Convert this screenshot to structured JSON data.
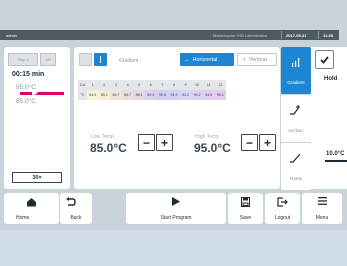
{
  "topbar": {
    "user": "admin",
    "device": "Mastercycler X50 Laborstation",
    "date": "2017-05-31",
    "time": "11:45"
  },
  "step": {
    "label": "Step 2",
    "counter": "1/3",
    "duration": "00:15 min",
    "temp_top": "95.0°C",
    "temp_bottom": "85.0°C",
    "cycles": "30×"
  },
  "gradient": {
    "title": "Gradient",
    "horizontal_label": "Horizontal",
    "vertical_label": "Vertical",
    "horizontal_arrow": "→",
    "vertical_arrow": "↑",
    "table": {
      "col_header": "Col",
      "columns": [
        "1",
        "2",
        "3",
        "4",
        "5",
        "6",
        "7",
        "8",
        "9",
        "10",
        "11",
        "12"
      ],
      "row_header": "°C",
      "values": [
        "84.9",
        "85.1",
        "85.7",
        "86.7",
        "88.1",
        "89.4",
        "90.6",
        "91.9",
        "93.2",
        "94.2",
        "94.9",
        "95.1"
      ],
      "colors": [
        "#f6f3d6",
        "#f3edd5",
        "#efe4d9",
        "#eadde0",
        "#e3d6e9",
        "#dbd1ee",
        "#d3cff2",
        "#d0d3f4",
        "#d5d7f5",
        "#dcd2f3",
        "#e5cdf1",
        "#eac9ef"
      ]
    },
    "low_temp_label": "Low Temp",
    "low_temp_value": "85.0°C",
    "high_temp_label": "High Temp",
    "high_temp_value": "95.0°C",
    "minus": "−",
    "plus": "+"
  },
  "side_tabs": [
    {
      "label": "Gradient",
      "icon": "gradient-bars-icon",
      "active": true
    },
    {
      "label": "Inc/Dec",
      "icon": "increment-icon",
      "active": false
    },
    {
      "label": "Ramp",
      "icon": "ramp-icon",
      "active": false
    }
  ],
  "next_step": {
    "label": "Hold",
    "temp": "10.0°C"
  },
  "bottom_bar": {
    "home": "Home",
    "back": "Back",
    "start": "Start Program",
    "save": "Save",
    "logout": "Logout",
    "menu": "Menu"
  },
  "colors": {
    "accent": "#1e86d1",
    "magenta": "#e0006e",
    "bar": "#4e5961"
  }
}
